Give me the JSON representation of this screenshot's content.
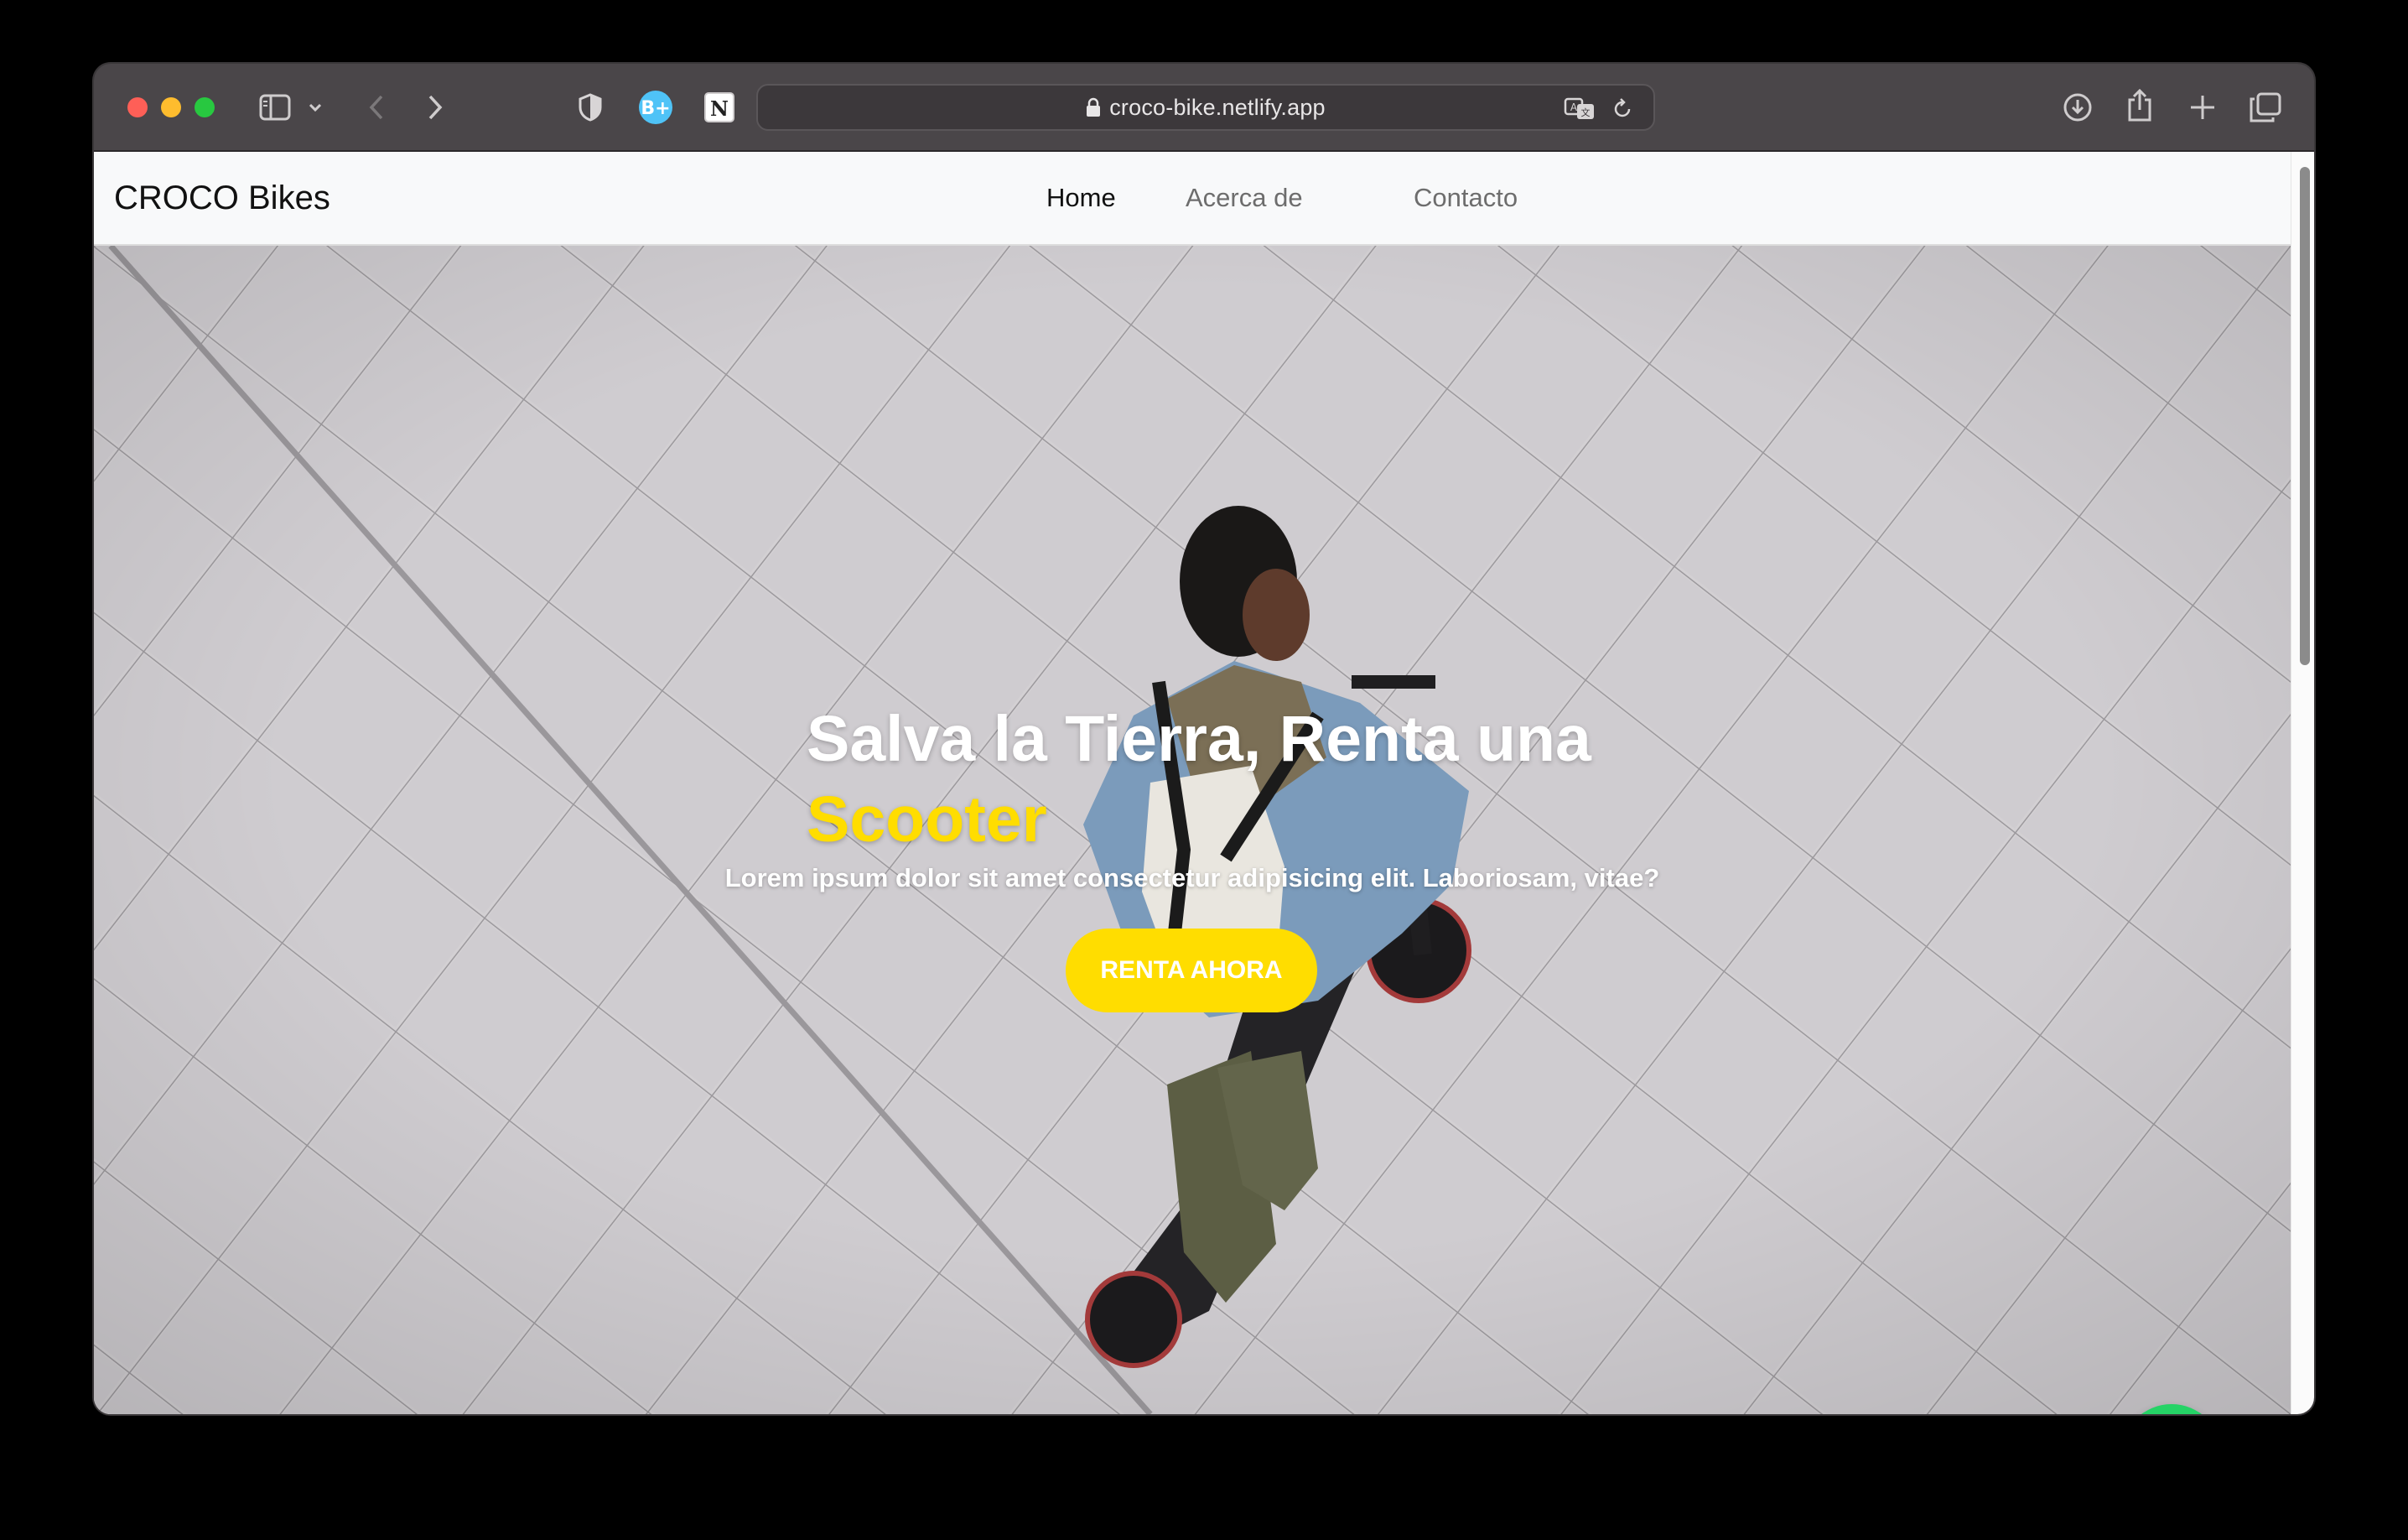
{
  "browser": {
    "url": "croco-bike.netlify.app",
    "icons": [
      "sidebar-icon",
      "chevron-down-icon",
      "back-icon",
      "forward-icon",
      "shield-icon",
      "extension-icon",
      "notion-icon",
      "lock-icon",
      "translate-icon",
      "reload-icon",
      "download-icon",
      "share-icon",
      "new-tab-icon",
      "tab-overview-icon"
    ]
  },
  "navbar": {
    "brand": "CROCO Bikes",
    "links": [
      {
        "label": "Home",
        "active": true
      },
      {
        "label": "Acerca de",
        "active": false
      },
      {
        "label": "Contacto",
        "active": false
      }
    ]
  },
  "hero": {
    "title_line1": "Salva la Tierra, Renta una",
    "title_accent": "Scooter",
    "subtitle": "Lorem ipsum dolor sit amet consectetur adipisicing elit. Laboriosam, vitae?",
    "cta_label": "RENTA AHORA"
  },
  "floating": {
    "whatsapp_icon": "whatsapp-icon"
  },
  "colors": {
    "accent": "#ffdd00",
    "whatsapp": "#25d366",
    "navbar_bg": "#f8f9fa"
  }
}
